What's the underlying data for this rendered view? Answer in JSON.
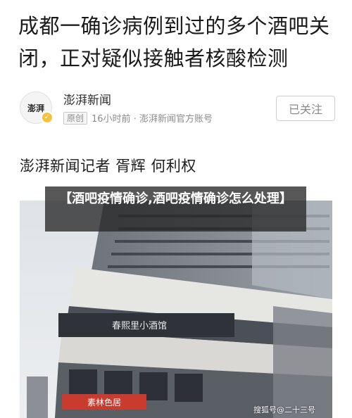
{
  "article": {
    "headline": "成都一确诊病例到过的多个酒吧关闭，正对疑似接触者核酸检测",
    "byline": "澎湃新闻记者 胥辉 何利权"
  },
  "author": {
    "avatar_text": "澎湃",
    "name": "澎湃新闻",
    "original_badge": "原创",
    "meta": "16小时前 · 澎湃新闻官方账号",
    "follow_label": "已关注",
    "verified_icon": "verified-check-icon"
  },
  "photo": {
    "overlay_title": "【酒吧疫情确诊,酒吧疫情确诊怎么处理】",
    "shop_sign": "春熙里小酒馆",
    "lower_sign": "素林色居",
    "watermark": "搜狐号@二十三号"
  },
  "colors": {
    "overlay_bg": "#282828",
    "verified": "#f6c23b",
    "follow_border": "#cfcfcf"
  }
}
